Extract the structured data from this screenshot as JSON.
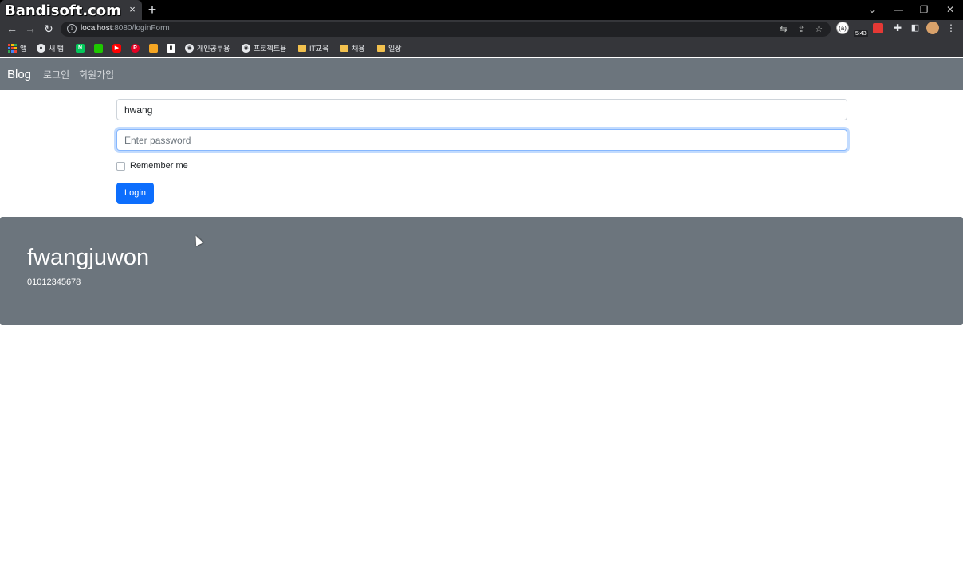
{
  "watermark": "Bandisoft.com",
  "browser": {
    "tab_close": "×",
    "new_tab": "+",
    "url_host": "localhost",
    "url_rest": ":8080/loginForm",
    "ext_label": "(a)",
    "ext_timer": "5:43",
    "bookmarks": {
      "apps": "앱",
      "new_tab": "새 탭",
      "naver": "N",
      "personal": "개인공부용",
      "project": "프로젝트용",
      "it": "IT교육",
      "hiring": "채용",
      "daily": "일상"
    }
  },
  "site": {
    "brand": "Blog",
    "nav": {
      "login": "로그인",
      "signup": "회원가입"
    }
  },
  "form": {
    "username_value": "hwang",
    "password_placeholder": "Enter password",
    "remember_label": "Remember me",
    "login_button": "Login"
  },
  "footer": {
    "title": "fwangjuwon",
    "phone": "01012345678"
  },
  "colors": {
    "navbar": "#6c757d",
    "primary": "#0d6efd",
    "chrome": "#35363a"
  }
}
